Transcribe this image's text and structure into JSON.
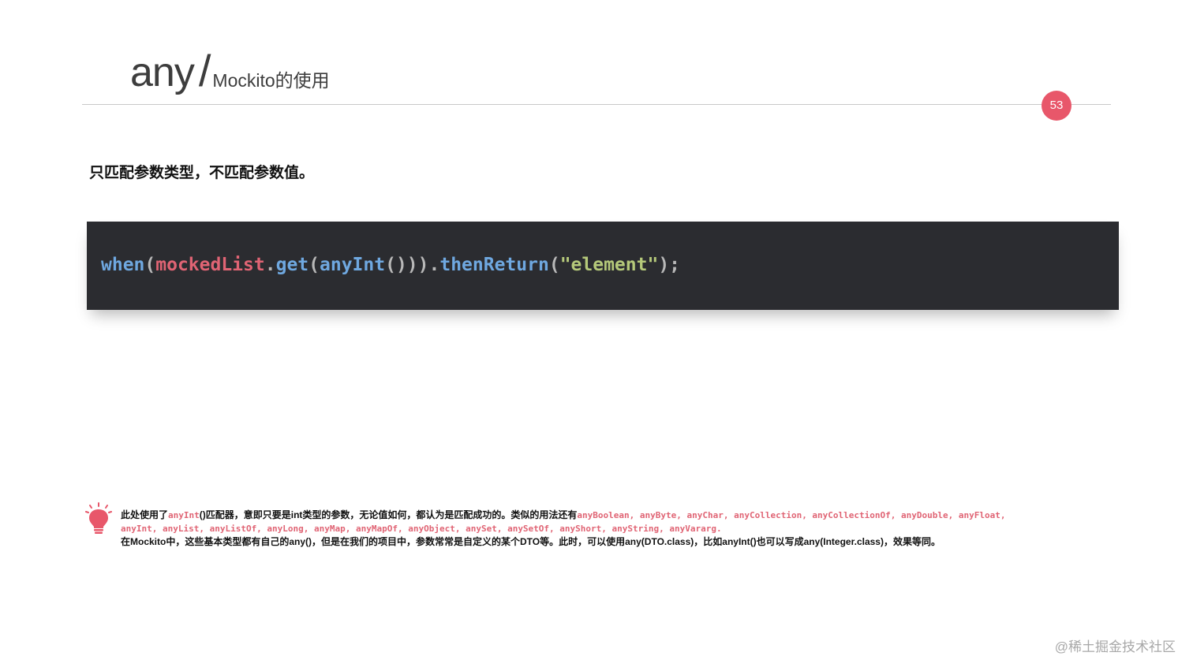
{
  "header": {
    "title_main": "any",
    "title_separator": "/",
    "title_sub": "Mockito的使用",
    "page_number": "53",
    "badge_color": "#e8576a"
  },
  "lead_text": "只匹配参数类型，不匹配参数值。",
  "code": {
    "tokens": [
      {
        "text": "when",
        "kind": "fn"
      },
      {
        "text": "(",
        "kind": "punct"
      },
      {
        "text": "mockedList",
        "kind": "var"
      },
      {
        "text": ".",
        "kind": "punct"
      },
      {
        "text": "get",
        "kind": "fn"
      },
      {
        "text": "(",
        "kind": "punct"
      },
      {
        "text": "anyInt",
        "kind": "fn"
      },
      {
        "text": "()))",
        "kind": "punct"
      },
      {
        "text": ".",
        "kind": "punct"
      },
      {
        "text": "thenReturn",
        "kind": "fn"
      },
      {
        "text": "(",
        "kind": "punct"
      },
      {
        "text": "\"element\"",
        "kind": "str"
      },
      {
        "text": ");",
        "kind": "punct"
      }
    ],
    "background": "#2b2c30"
  },
  "tip": {
    "icon": "lightbulb-icon",
    "line1_prefix": "此处使用了",
    "line1_code1": "anyInt",
    "line1_middle": "()匹配器，意即只要是int类型的参数，无论值如何，都认为是匹配成功的。类似的用法还有",
    "line1_code2": "anyBoolean, anyByte, anyChar, anyCollection, anyCollectionOf, anyDouble, anyFloat,",
    "line2_code": "anyInt, anyList, anyListOf, anyLong, anyMap, anyMapOf, anyObject, anySet, anySetOf, anyShort, anyString, anyVararg.",
    "line3": "在Mockito中，这些基本类型都有自己的any()，但是在我们的项目中，参数常常是自定义的某个DTO等。此时，可以使用any(DTO.class)，比如anyInt()也可以写成any(Integer.class)，效果等同。"
  },
  "watermark": "@稀土掘金技术社区"
}
